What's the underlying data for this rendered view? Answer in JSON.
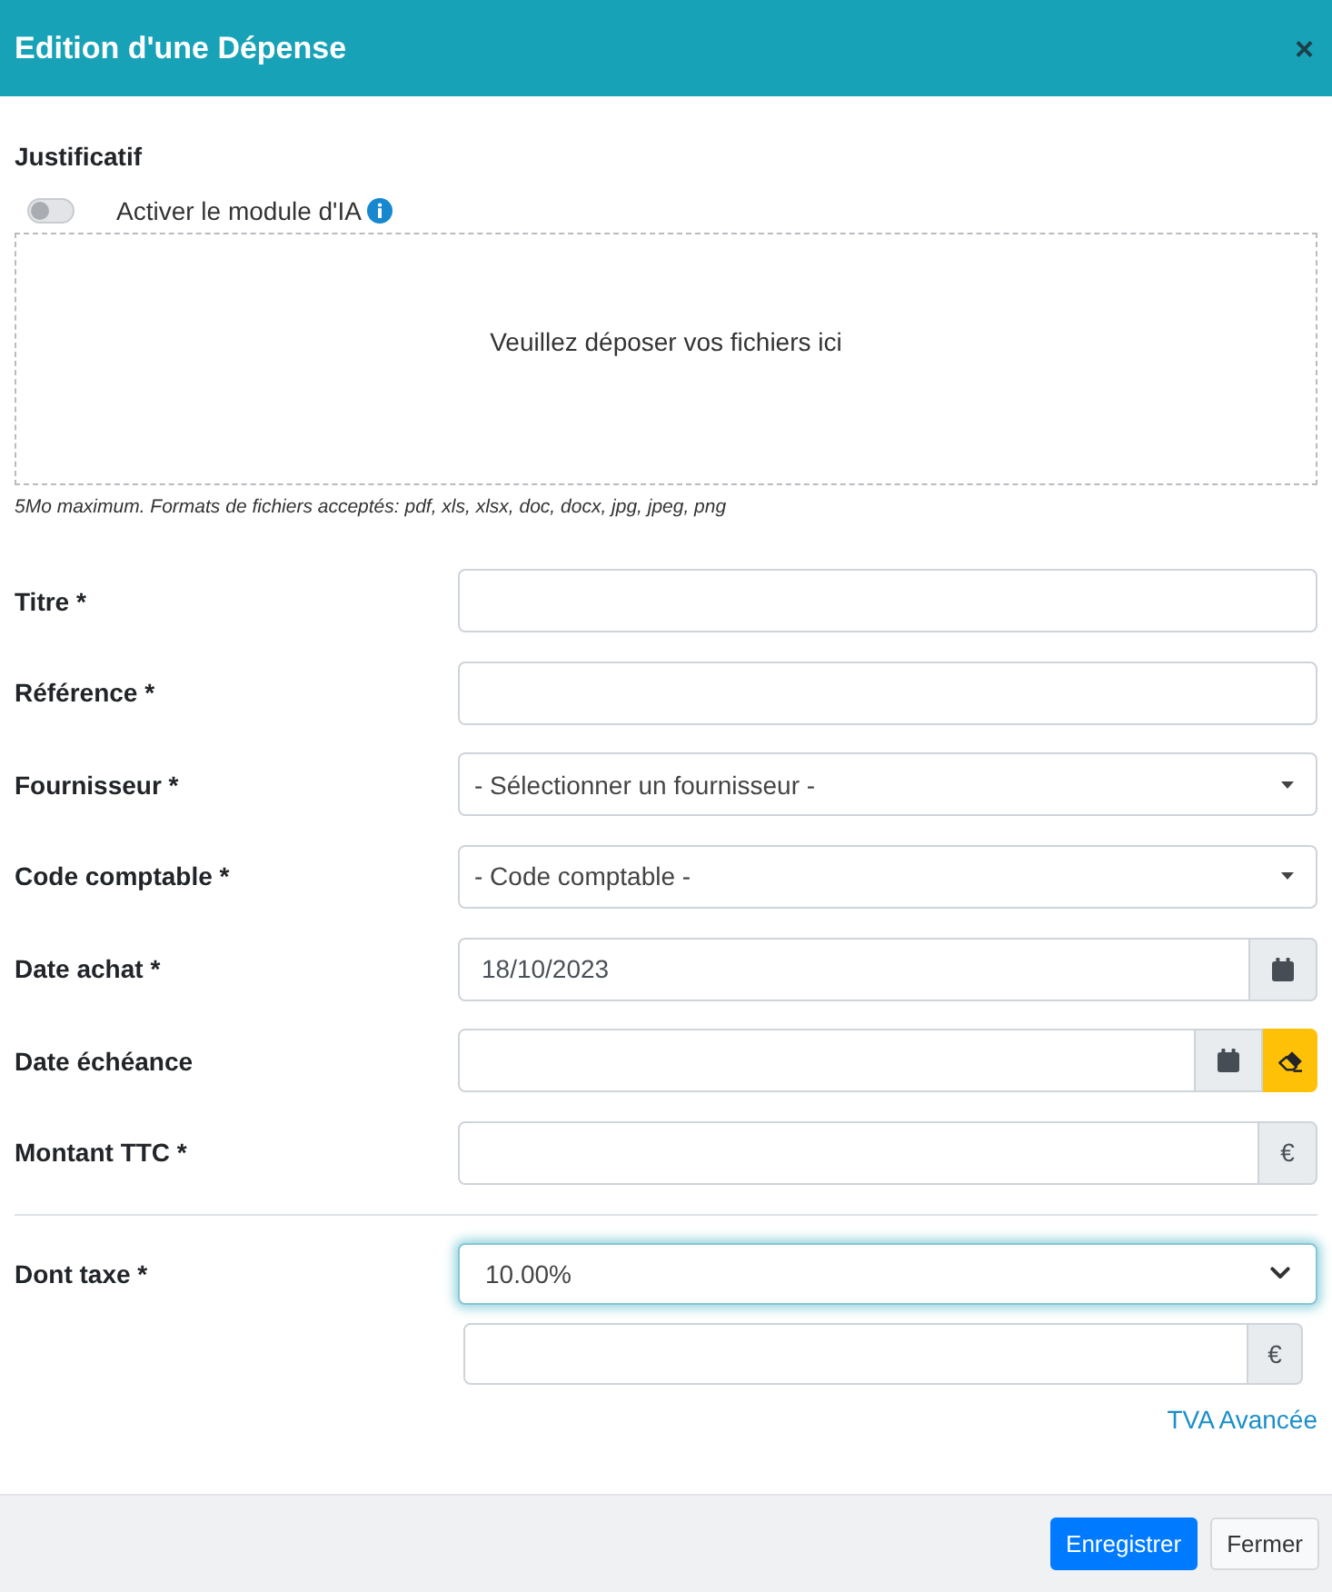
{
  "dialog": {
    "title": "Edition d'une Dépense",
    "close": "×"
  },
  "attachment": {
    "heading": "Justificatif",
    "ai_toggle": {
      "label": "Activer le module d'IA",
      "on": false
    },
    "dropzone": {
      "text": "Veuillez déposer vos fichiers ici"
    },
    "hint": "5Mo maximum. Formats de fichiers acceptés: pdf, xls, xlsx, doc, docx, jpg, jpeg, png"
  },
  "fields": [
    {
      "kind": "text",
      "label": "Titre *"
    },
    {
      "kind": "text",
      "label": "Référence *"
    },
    {
      "kind": "select",
      "label": "Fournisseur *",
      "value": "- Sélectionner un fournisseur -"
    },
    {
      "kind": "select",
      "label": "Code comptable *",
      "value": "- Code comptable -"
    },
    {
      "kind": "date",
      "label": "Date achat *",
      "value": "18/10/2023"
    },
    {
      "kind": "date_clearable",
      "label": "Date échéance"
    },
    {
      "kind": "currency",
      "label": "Montant TTC *",
      "addon": "€"
    }
  ],
  "tax": {
    "label": "Dont taxe *",
    "rate": {
      "value": "10.00%",
      "focused": true
    },
    "amount": {
      "addon": "€"
    },
    "advanced_link": "TVA Avancée"
  },
  "buttons": [
    {
      "label": "Enregistrer",
      "kind": "primary"
    },
    {
      "label": "Fermer",
      "kind": "secondary"
    }
  ]
}
